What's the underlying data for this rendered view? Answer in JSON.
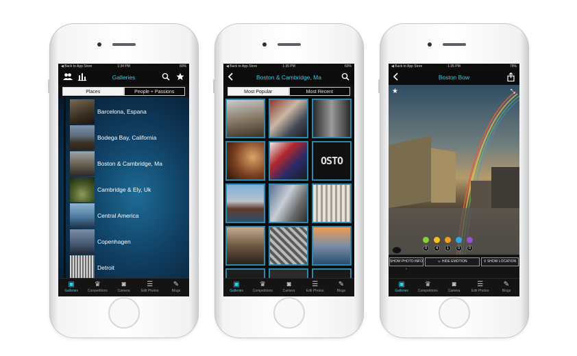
{
  "status": {
    "back": "◀ Back to App Store",
    "time1": "1:34 PM",
    "time2": "1:35 PM",
    "time3": "1:35 PM",
    "batt1": "60%",
    "batt2": "60%",
    "batt3": "79%"
  },
  "screen1": {
    "title": "Galleries",
    "segments": [
      "Places",
      "People + Passions"
    ],
    "items": [
      "Barcelona, Espana",
      "Bodega Bay, California",
      "Boston & Cambridge, Ma",
      "Cambridge & Ely, Uk",
      "Central America",
      "Copenhagen",
      "Detroit"
    ]
  },
  "screen2": {
    "title": "Boston & Cambridge, Ma",
    "segments": [
      "Most Popular",
      "Most Recent"
    ],
    "grid_tile_text": "OSTO"
  },
  "screen3": {
    "title": "Boston Bow",
    "counts": [
      "0",
      "4",
      "1",
      "0",
      "0"
    ],
    "buttons": [
      "SHOW PHOTO INFO",
      "HIDE EMOTION",
      "SHOW LOCATION"
    ]
  },
  "tabs": [
    "Galleries",
    "Competitions",
    "Camera",
    "Edit Photos",
    "Blogs"
  ],
  "colors": {
    "accent": "#2fd0ea"
  },
  "icons": [
    "people-icon",
    "stats-icon",
    "search-icon",
    "star-icon",
    "back-icon",
    "share-icon",
    "expand-icon",
    "image-icon",
    "trophy-icon",
    "camera-icon",
    "sliders-icon",
    "blog-icon"
  ]
}
